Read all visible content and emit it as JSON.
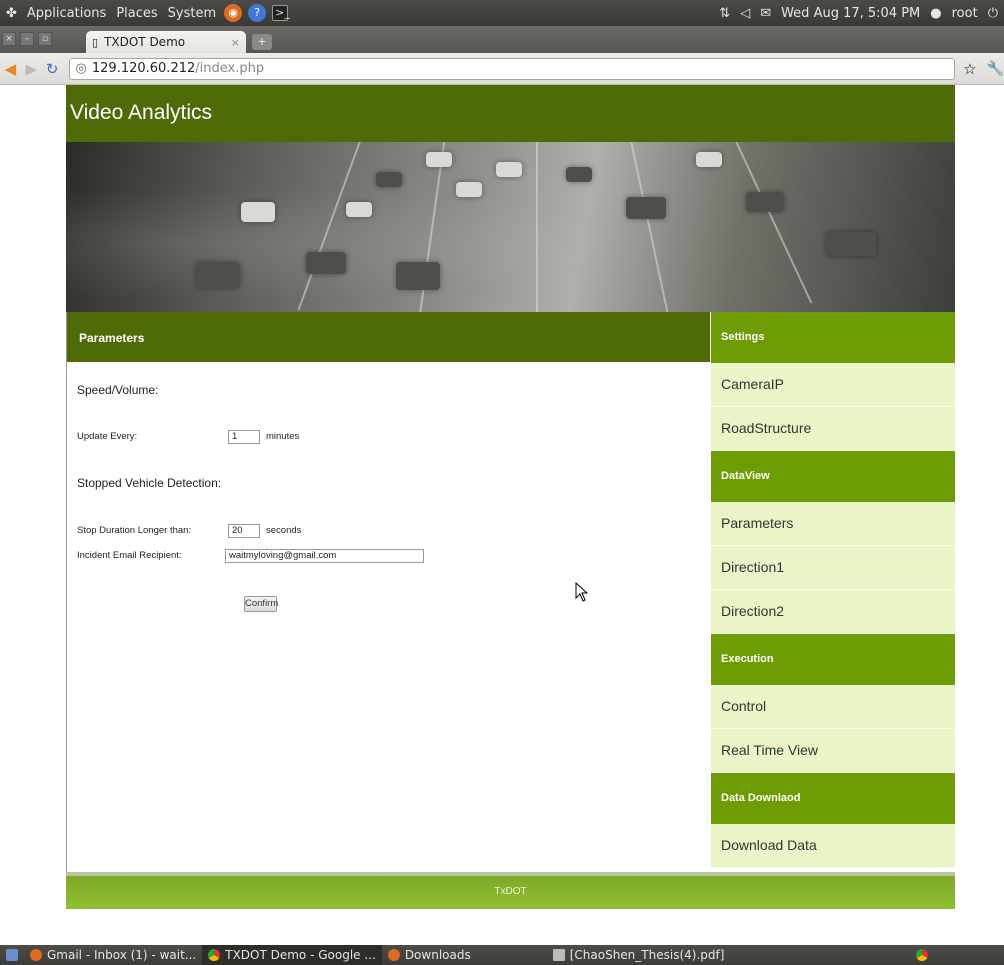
{
  "system_bar": {
    "menus": [
      "Applications",
      "Places",
      "System"
    ],
    "datetime": "Wed Aug 17,  5:04 PM",
    "user": "root"
  },
  "browser": {
    "tab_title": "TXDOT Demo",
    "url_host": "129.120.60.212",
    "url_path": "/index.php"
  },
  "site": {
    "title": "Video Analytics",
    "footer": "TxDOT"
  },
  "form": {
    "heading": "Parameters",
    "speed_volume": "Speed/Volume:",
    "update_every_label": "Update Every:",
    "update_every_value": "1",
    "update_every_unit": "minutes",
    "stopped_vehicle": "Stopped Vehicle Detection:",
    "stop_duration_label": "Stop Duration Longer than:",
    "stop_duration_value": "20",
    "stop_duration_unit": "seconds",
    "email_label": "Incident Email Recipient:",
    "email_value": "waitmyloving@gmail.com",
    "confirm": "Confirm"
  },
  "sidebar": {
    "sections": [
      {
        "heading": "Settings",
        "items": [
          "CameraIP",
          "RoadStructure"
        ]
      },
      {
        "heading": "DataView",
        "items": [
          "Parameters",
          "Direction1",
          "Direction2"
        ]
      },
      {
        "heading": "Execution",
        "items": [
          "Control",
          "Real Time View"
        ]
      },
      {
        "heading": "Data Downlaod",
        "items": [
          "Download Data"
        ]
      }
    ]
  },
  "taskbar": {
    "tasks": [
      "Gmail - Inbox (1) - wait...",
      "TXDOT Demo - Google ...",
      "Downloads",
      "[ChaoShen_Thesis(4).pdf]"
    ]
  },
  "colors": {
    "header_green": "#4f6b08",
    "sidebar_head": "#6e9c04",
    "sidebar_item": "#e9f5c7",
    "footer_green": "#8ec12f"
  }
}
